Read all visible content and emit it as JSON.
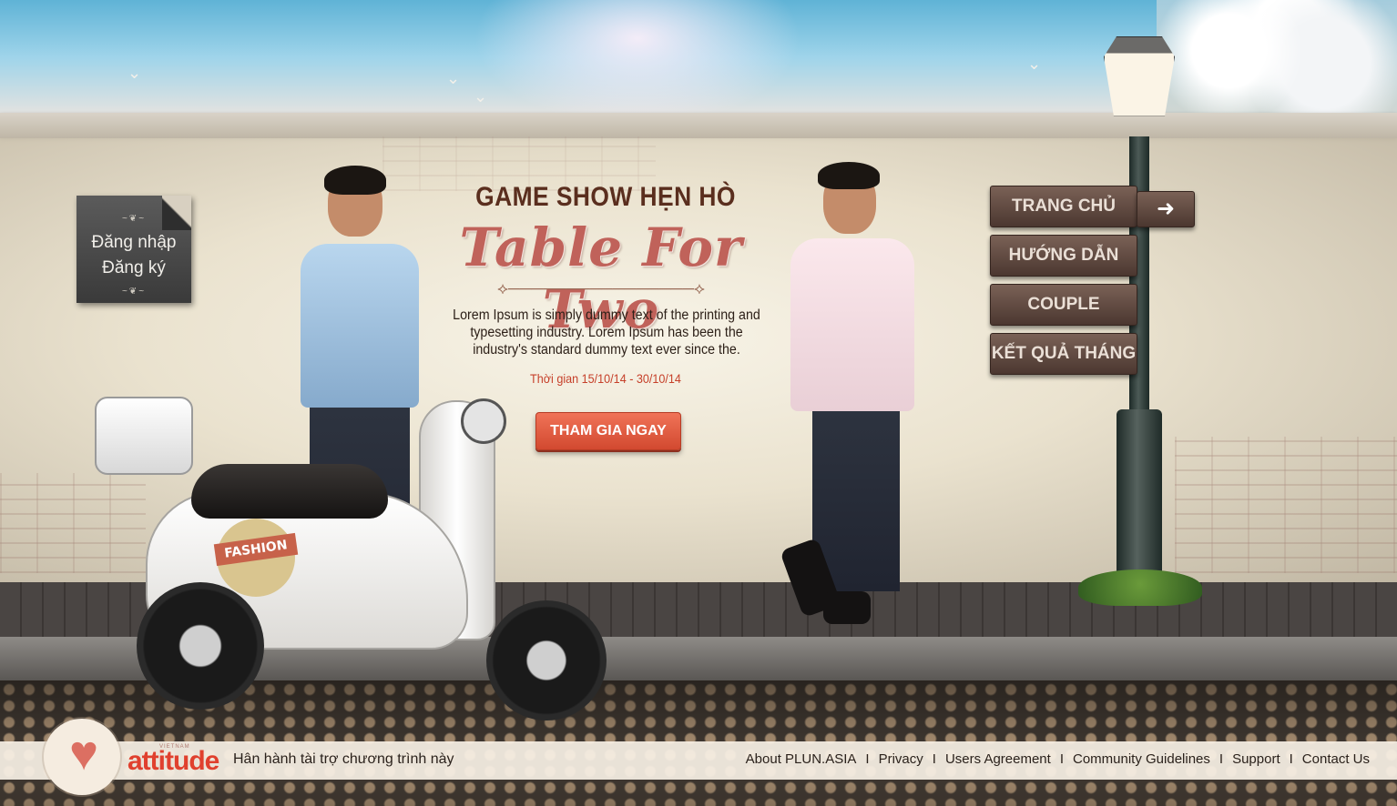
{
  "login": {
    "login_label": "Đăng nhập",
    "register_label": "Đăng ký"
  },
  "hero": {
    "title_small": "GAME SHOW HẸN HÒ",
    "title_script": "Table For Two",
    "description": "Lorem Ipsum is simply dummy text of the printing and typesetting industry. Lorem Ipsum has been the industry's standard dummy text ever since the.",
    "dates": "Thời gian 15/10/14 - 30/10/14",
    "cta_label": "THAM GIA NGAY",
    "scooter_badge": "FASHION"
  },
  "nav": {
    "items": [
      {
        "label": "TRANG CHỦ"
      },
      {
        "label": "HƯỚNG DẪN"
      },
      {
        "label": "COUPLE"
      },
      {
        "label": "KẾT QUẢ THÁNG"
      }
    ],
    "arrow_icon": "arrow-right-icon"
  },
  "footer": {
    "brand": "attitude",
    "brand_small": "VIETNAM",
    "sponsor_text": "Hân hành tài trợ chương trình này",
    "links": [
      {
        "label": "About PLUN.ASIA"
      },
      {
        "label": "Privacy"
      },
      {
        "label": "Users Agreement"
      },
      {
        "label": "Community Guidelines"
      },
      {
        "label": "Support"
      },
      {
        "label": "Contact Us"
      }
    ],
    "separator": "I"
  },
  "colors": {
    "accent": "#d24930",
    "title_brown": "#5a2e1e",
    "script_pink": "#c0625a",
    "nav_brown": "#5e4a40"
  }
}
